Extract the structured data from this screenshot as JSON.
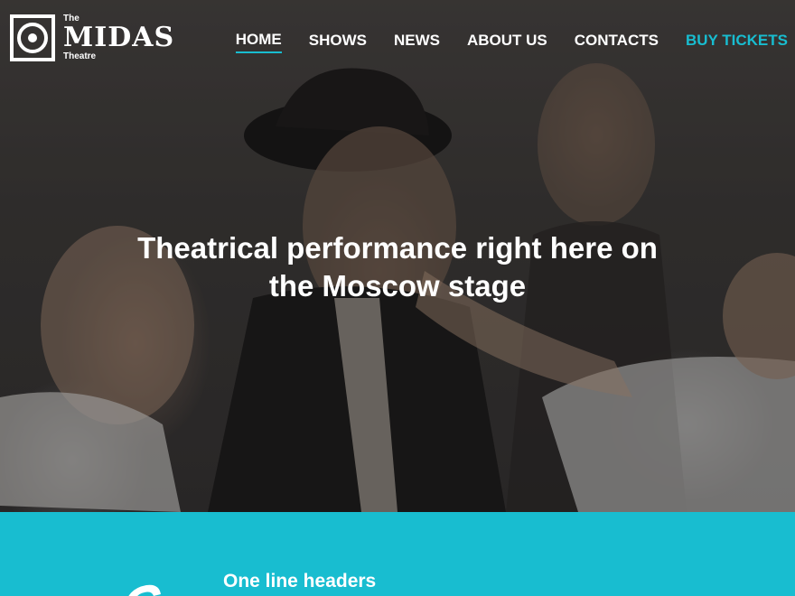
{
  "logo": {
    "the": "The",
    "name": "MIDAS",
    "sub": "Theatre"
  },
  "nav": {
    "items": [
      {
        "label": "HOME",
        "active": true
      },
      {
        "label": "SHOWS",
        "active": false
      },
      {
        "label": "NEWS",
        "active": false
      },
      {
        "label": "ABOUT US",
        "active": false
      },
      {
        "label": "CONTACTS",
        "active": false
      }
    ],
    "cta": "BUY TICKETS"
  },
  "hero": {
    "title": "Theatrical performance right here on the Moscow stage"
  },
  "band": {
    "heading": "One line headers"
  },
  "colors": {
    "accent": "#18bdd0",
    "text": "#ffffff"
  }
}
